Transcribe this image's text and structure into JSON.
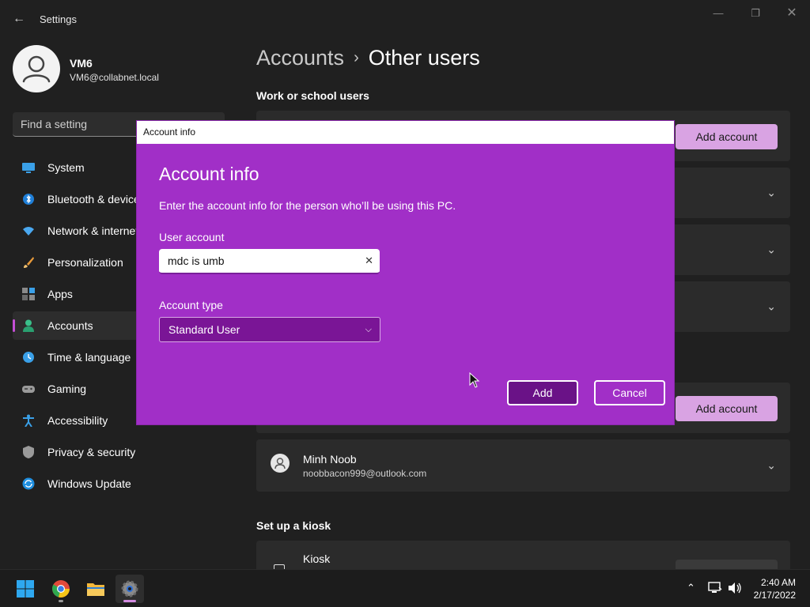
{
  "window": {
    "title": "Settings",
    "back_icon": "arrow-left-icon",
    "controls": [
      "minimize-icon",
      "maximize-icon",
      "close-icon"
    ]
  },
  "user": {
    "name": "VM6",
    "email": "VM6@collabnet.local"
  },
  "search": {
    "placeholder": "Find a setting"
  },
  "sidebar": {
    "items": [
      {
        "label": "System",
        "icon": "monitor-icon"
      },
      {
        "label": "Bluetooth & devices",
        "icon": "bluetooth-icon"
      },
      {
        "label": "Network & internet",
        "icon": "wifi-icon"
      },
      {
        "label": "Personalization",
        "icon": "brush-icon"
      },
      {
        "label": "Apps",
        "icon": "apps-icon"
      },
      {
        "label": "Accounts",
        "icon": "person-icon",
        "selected": true
      },
      {
        "label": "Time & language",
        "icon": "clock-globe-icon"
      },
      {
        "label": "Gaming",
        "icon": "gamepad-icon"
      },
      {
        "label": "Accessibility",
        "icon": "accessibility-icon"
      },
      {
        "label": "Privacy & security",
        "icon": "shield-icon"
      },
      {
        "label": "Windows Update",
        "icon": "update-icon"
      }
    ]
  },
  "breadcrumb": {
    "parent": "Accounts",
    "separator": "›",
    "current": "Other users"
  },
  "sections": {
    "work_school": "Work or school users",
    "kiosk": "Set up a kiosk"
  },
  "buttons": {
    "add_account": "Add account"
  },
  "other_user": {
    "name": "Minh Noob",
    "email": "noobbacon999@outlook.com"
  },
  "kiosk": {
    "title": "Kiosk"
  },
  "dialog": {
    "window_title": "Account info",
    "heading": "Account info",
    "description": "Enter the account info for the person who’ll be using this PC.",
    "user_account_label": "User account",
    "user_account_value": "mdc is umb",
    "account_type_label": "Account type",
    "account_type_value": "Standard User",
    "add_label": "Add",
    "cancel_label": "Cancel"
  },
  "taskbar": {
    "apps": [
      "windows-start-icon",
      "chrome-icon",
      "file-explorer-icon",
      "settings-gear-icon"
    ],
    "tray": [
      "chevron-up-icon",
      "network-icon",
      "volume-icon"
    ],
    "time": "2:40 AM",
    "date": "2/17/2022"
  },
  "colors": {
    "accent": "#c44fd6",
    "dialog_bg": "#a12fc7",
    "button_accent": "#d9a3e3"
  }
}
